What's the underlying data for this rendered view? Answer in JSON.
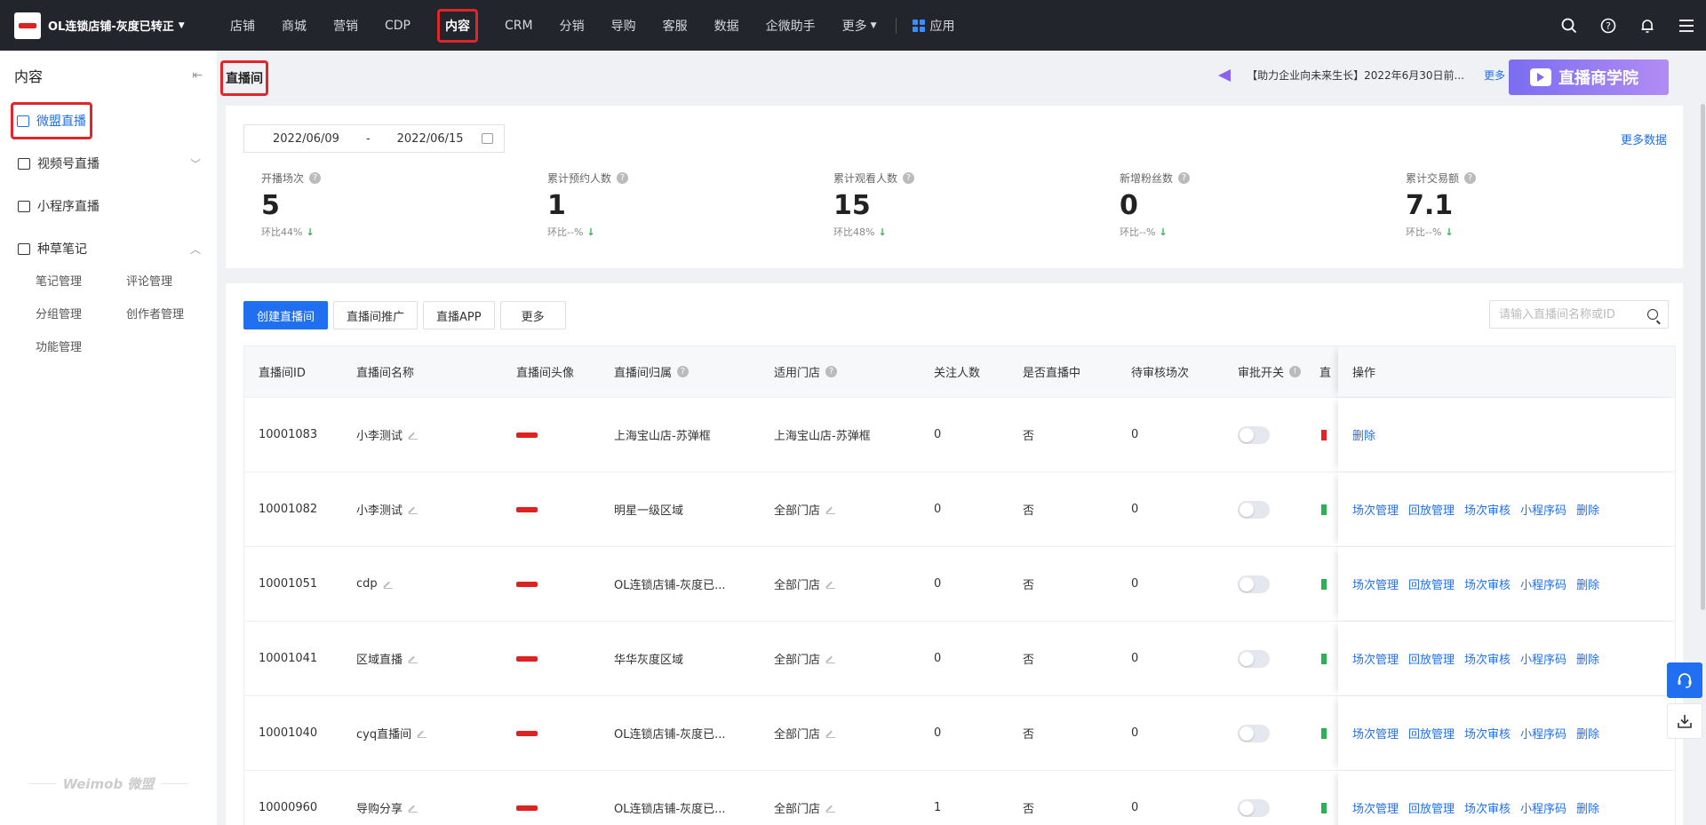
{
  "topbar": {
    "shop_name": "OL连锁店铺-灰度已转正",
    "nav": [
      "店铺",
      "商城",
      "营销",
      "CDP",
      "内容",
      "CRM",
      "分销",
      "导购",
      "客服",
      "数据",
      "企微助手",
      "更多"
    ],
    "apps_label": "应用",
    "active_nav": "内容"
  },
  "sidebar": {
    "title": "内容",
    "items": [
      {
        "label": "微盟直播",
        "active": true
      },
      {
        "label": "视频号直播",
        "expand": "v"
      },
      {
        "label": "小程序直播"
      },
      {
        "label": "种草笔记",
        "expand": "^"
      }
    ],
    "sub_items": [
      "笔记管理",
      "评论管理",
      "分组管理",
      "创作者管理",
      "功能管理"
    ],
    "brand": "Weimob 微盟"
  },
  "page": {
    "title": "直播间",
    "notice": "【助力企业向未来生长】2022年6月30日前...",
    "notice_more": "更多",
    "banner": "直播商学院"
  },
  "stats": {
    "date_start": "2022/06/09",
    "date_sep": "-",
    "date_end": "2022/06/15",
    "more_data": "更多数据",
    "items": [
      {
        "label": "开播场次",
        "value": "5",
        "cmp": "环比44%"
      },
      {
        "label": "累计预约人数",
        "value": "1",
        "cmp": "环比--%"
      },
      {
        "label": "累计观看人数",
        "value": "15",
        "cmp": "环比48%"
      },
      {
        "label": "新增粉丝数",
        "value": "0",
        "cmp": "环比--%"
      },
      {
        "label": "累计交易额",
        "value": "7.1",
        "cmp": "环比--%"
      }
    ]
  },
  "toolbar": {
    "create": "创建直播间",
    "promote": "直播间推广",
    "app": "直播APP",
    "more": "更多",
    "search_placeholder": "请输入直播间名称或ID"
  },
  "table": {
    "headers": [
      "直播间ID",
      "直播间名称",
      "直播间头像",
      "直播间归属",
      "适用门店",
      "关注人数",
      "是否直播中",
      "待审核场次",
      "审批开关",
      "直",
      "操作"
    ],
    "rows": [
      {
        "id": "10001083",
        "name": "小李测试",
        "owner": "上海宝山店-苏弹框",
        "store": "上海宝山店-苏弹框",
        "follow": "0",
        "live": "否",
        "pending": "0",
        "ops": [
          "删除"
        ]
      },
      {
        "id": "10001082",
        "name": "小李测试",
        "owner": "明星一级区域",
        "store": "全部门店",
        "follow": "0",
        "live": "否",
        "pending": "0",
        "ops": [
          "场次管理",
          "回放管理",
          "场次审核",
          "小程序码",
          "删除"
        ]
      },
      {
        "id": "10001051",
        "name": "cdp",
        "owner": "OL连锁店铺-灰度已...",
        "store": "全部门店",
        "follow": "0",
        "live": "否",
        "pending": "0",
        "ops": [
          "场次管理",
          "回放管理",
          "场次审核",
          "小程序码",
          "删除"
        ]
      },
      {
        "id": "10001041",
        "name": "区域直播",
        "owner": "华华灰度区域",
        "store": "全部门店",
        "follow": "0",
        "live": "否",
        "pending": "0",
        "ops": [
          "场次管理",
          "回放管理",
          "场次审核",
          "小程序码",
          "删除"
        ]
      },
      {
        "id": "10001040",
        "name": "cyq直播间",
        "owner": "OL连锁店铺-灰度已...",
        "store": "全部门店",
        "follow": "0",
        "live": "否",
        "pending": "0",
        "ops": [
          "场次管理",
          "回放管理",
          "场次审核",
          "小程序码",
          "删除"
        ]
      },
      {
        "id": "10000960",
        "name": "导购分享",
        "owner": "OL连锁店铺-灰度已...",
        "store": "全部门店",
        "follow": "1",
        "live": "否",
        "pending": "0",
        "ops": [
          "场次管理",
          "回放管理",
          "场次审核",
          "小程序码",
          "删除"
        ]
      }
    ]
  },
  "colors": {
    "accent": "#1f6ff0",
    "highlight": "#e0252b",
    "topbar": "#22252b"
  }
}
